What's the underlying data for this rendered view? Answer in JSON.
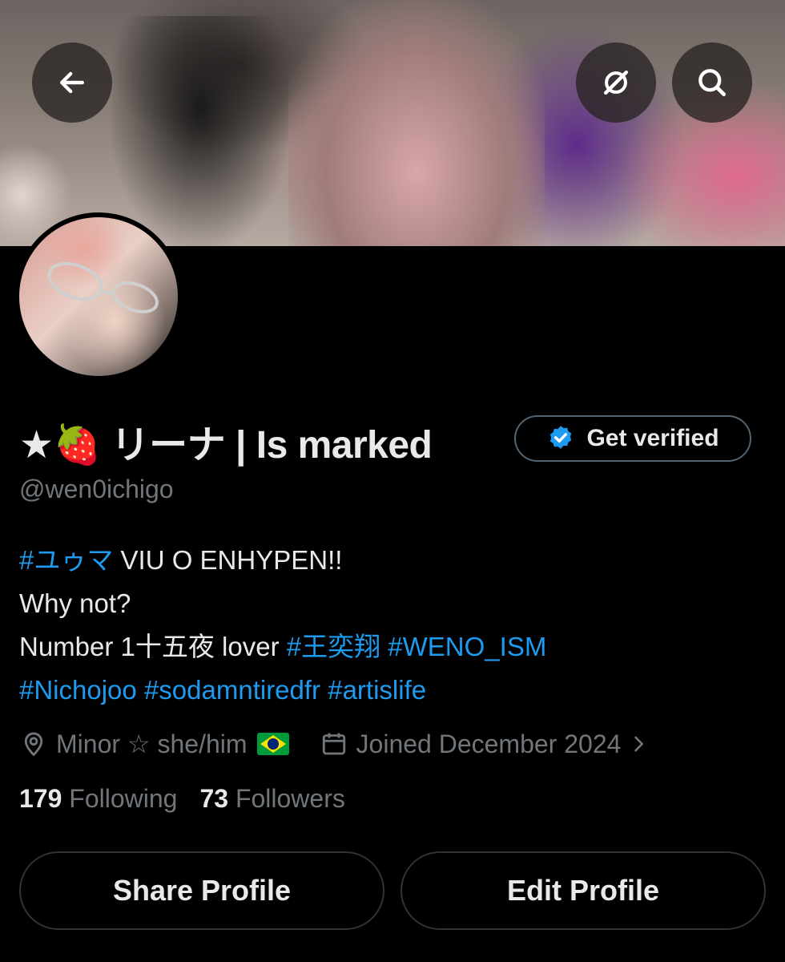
{
  "header": {
    "back_icon": "arrow-left-icon",
    "grok_icon": "grok-slash-icon",
    "search_icon": "search-icon"
  },
  "profile": {
    "display_name": "★🍓 リーナ | Is marked",
    "handle": "@wen0ichigo",
    "get_verified_label": "Get verified",
    "verified_badge_color": "#1d9bf0"
  },
  "bio": {
    "line1_tag": "#ユゥマ",
    "line1_text": " VIU O ENHYPEN!!",
    "line2_text": "Why not?",
    "line3_text": "Number 1十五夜 lover ",
    "line3_tag1": "#王奕翔",
    "line3_tag2": "#WENO_ISM",
    "line4_tag1": "#Nichojoo",
    "line4_tag2": "#sodamntiredfr",
    "line4_tag3": "#artislife"
  },
  "meta": {
    "location": "Minor ☆ she/him",
    "joined": "Joined December 2024"
  },
  "stats": {
    "following_count": "179",
    "following_label": "Following",
    "followers_count": "73",
    "followers_label": "Followers"
  },
  "actions": {
    "share_label": "Share Profile",
    "edit_label": "Edit Profile"
  },
  "colors": {
    "background": "#000000",
    "accent": "#1d9bf0",
    "muted": "#71767b",
    "text": "#e7e9ea"
  }
}
